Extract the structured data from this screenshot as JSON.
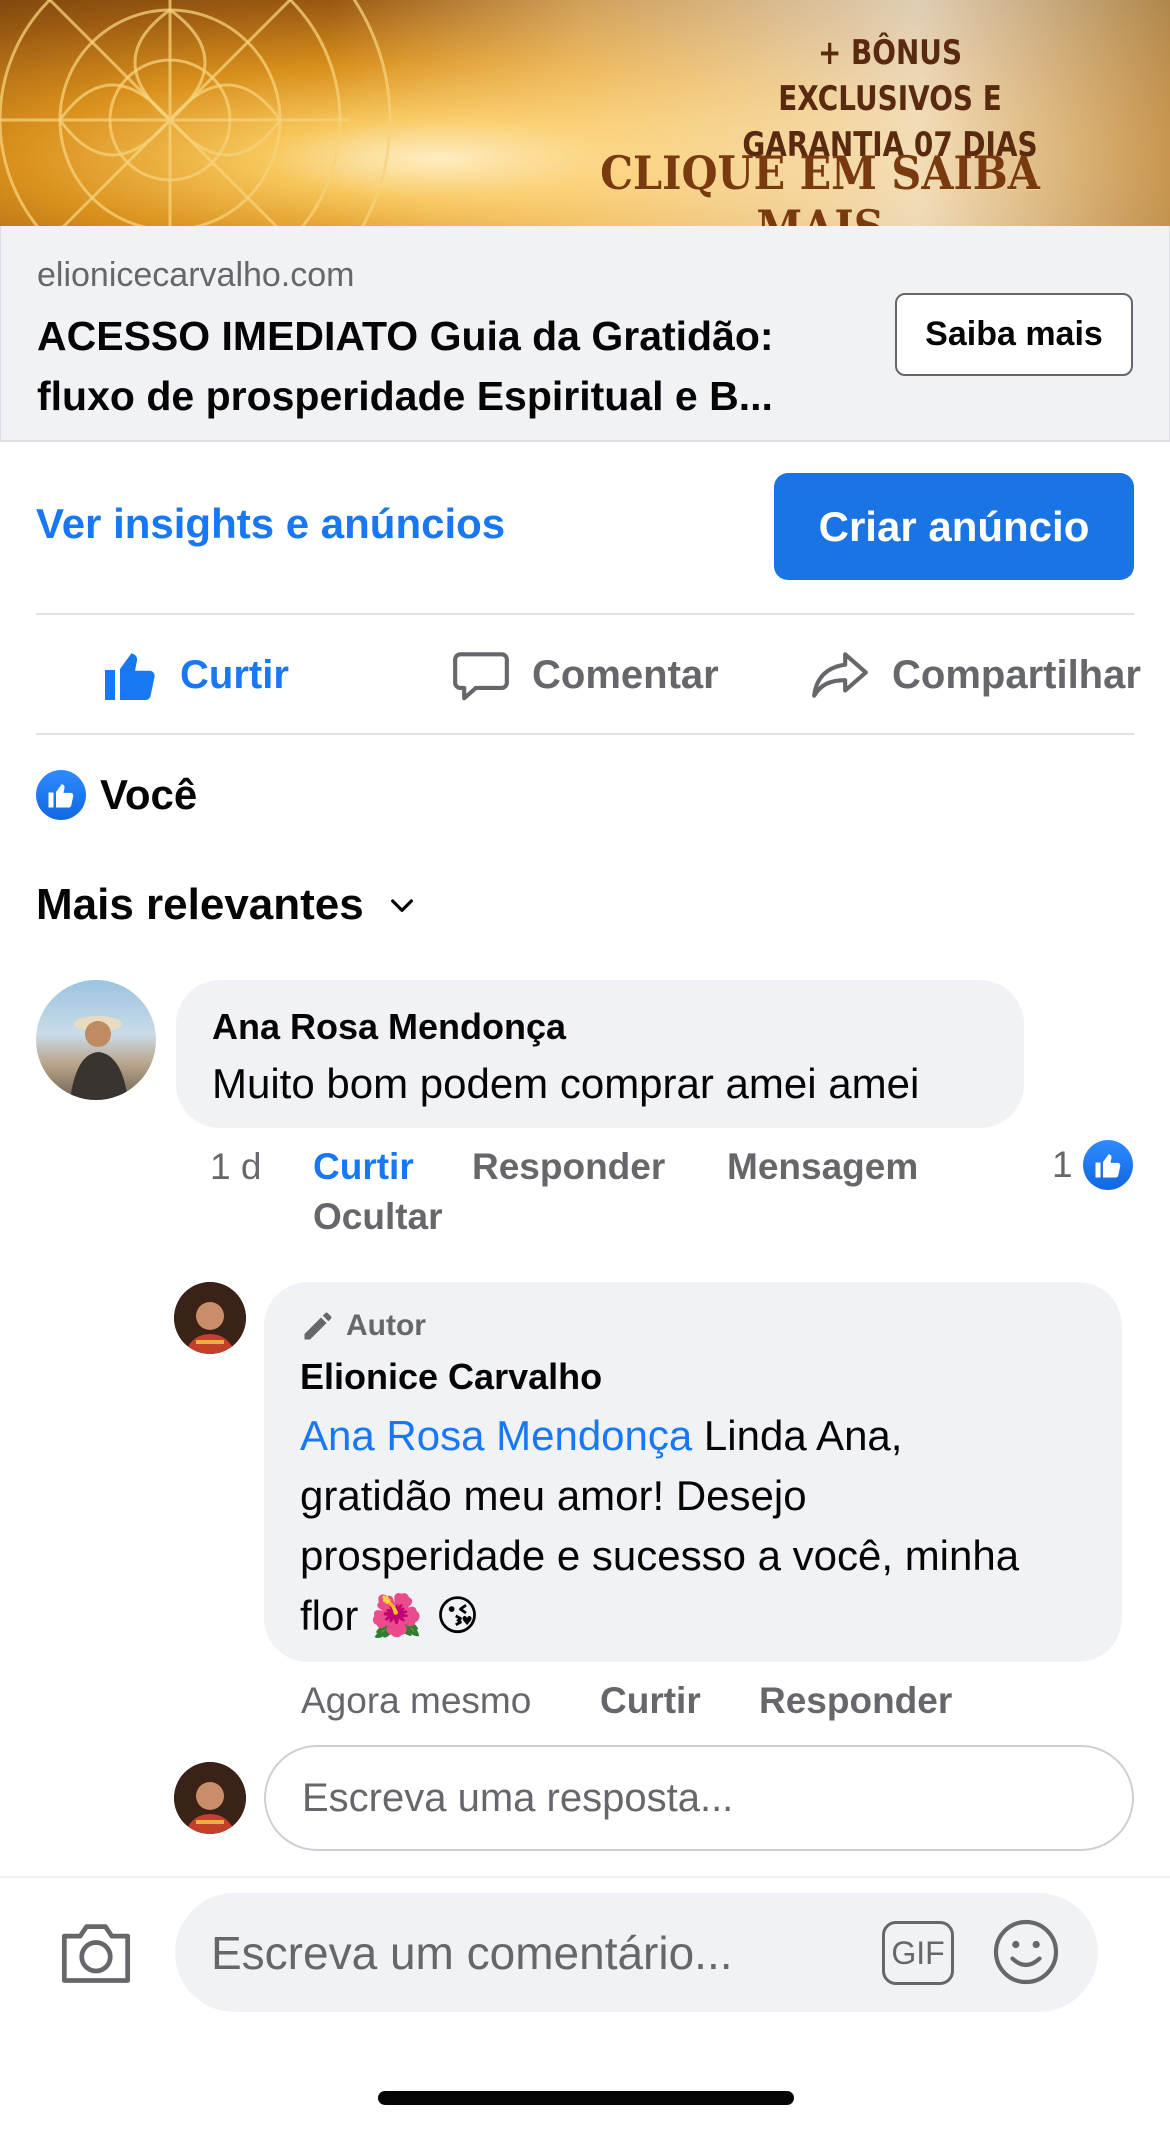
{
  "ad": {
    "banner_bonus": "+ BÔNUS EXCLUSIVOS E GARANTIA 07 DIAS",
    "banner_cta": "CLIQUE EM SAIBA MAIS",
    "domain": "elionicecarvalho.com",
    "title": "ACESSO IMEDIATO Guia da Gratidão: fluxo de prosperidade Espiritual e B...",
    "cta_button": "Saiba mais"
  },
  "insights": {
    "link": "Ver insights e anúncios",
    "create_ad": "Criar anúncio"
  },
  "actions": {
    "like": "Curtir",
    "comment": "Comentar",
    "share": "Compartilhar"
  },
  "reactions": {
    "label": "Você"
  },
  "sort": {
    "label": "Mais relevantes"
  },
  "comments": [
    {
      "author": "Ana Rosa Mendonça",
      "text": "Muito bom podem comprar amei amei",
      "time": "1 d",
      "like": "Curtir",
      "reply": "Responder",
      "message": "Mensagem",
      "hide": "Ocultar",
      "reaction_count": "1"
    }
  ],
  "reply": {
    "badge": "Autor",
    "author": "Elionice Carvalho",
    "mention": "Ana Rosa Mendonça",
    "text_line1": " Linda Ana,",
    "text_line2": "gratidão meu amor! Desejo",
    "text_line3": "prosperidade e sucesso a você, minha",
    "text_line4": "flor",
    "emojis": "🌺 😘",
    "time": "Agora mesmo",
    "like": "Curtir",
    "reply": "Responder"
  },
  "reply_input": {
    "placeholder": "Escreva uma resposta..."
  },
  "composer": {
    "placeholder": "Escreva um comentário...",
    "gif_label": "GIF"
  },
  "colors": {
    "brand_blue": "#1877f2",
    "button_blue": "#1b74e4",
    "muted": "#65676b",
    "bubble_bg": "#f0f2f5"
  }
}
